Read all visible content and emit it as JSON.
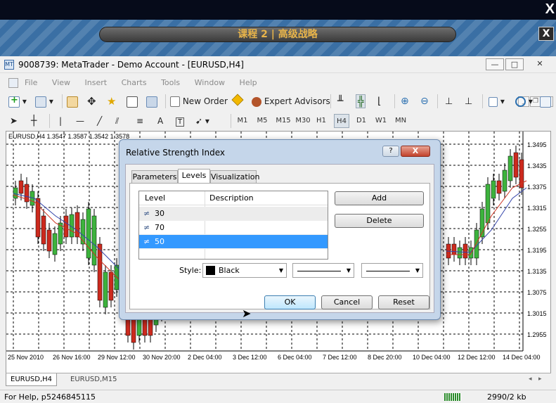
{
  "overlay": {
    "close_glyph": "X",
    "banner_title": "课程 2 | 高级战略",
    "banner_close": "X"
  },
  "window": {
    "title": "9008739: MetaTrader - Demo Account - [EURUSD,H4]",
    "min": "—",
    "max": "□",
    "close": "✕"
  },
  "menu": [
    "File",
    "View",
    "Insert",
    "Charts",
    "Tools",
    "Window",
    "Help"
  ],
  "toolbar": {
    "new_order": "New Order",
    "expert_advisors": "Expert Advisors"
  },
  "timeframes": [
    "M1",
    "M5",
    "M15",
    "M30",
    "H1",
    "H4",
    "D1",
    "W1",
    "MN"
  ],
  "selected_timeframe": "H4",
  "chart": {
    "label": "EURUSD,H4  1.3547 1.3587 1.3542 1.3578",
    "price_axis": [
      "1.3495",
      "1.3435",
      "1.3375",
      "1.3315",
      "1.3255",
      "1.3195",
      "1.3135",
      "1.3075",
      "1.3015",
      "1.2955"
    ],
    "date_axis": [
      "25 Nov 2010",
      "26 Nov 16:00",
      "29 Nov 12:00",
      "30 Nov 20:00",
      "2 Dec 04:00",
      "3 Dec 12:00",
      "6 Dec 04:00",
      "7 Dec 12:00",
      "8 Dec 20:00",
      "10 Dec 04:00",
      "12 Dec 12:00",
      "14 Dec 04:00"
    ],
    "up_color": "#3db33d",
    "down_color": "#cc2a1e"
  },
  "chart_tabs": [
    "EURUSD,H4",
    "EURUSD,M15"
  ],
  "status": {
    "help": "For Help, p",
    "number": "5246845115",
    "traffic": "2990/2 kb"
  },
  "dialog": {
    "title": "Relative Strength Index",
    "help": "?",
    "close": "X",
    "tabs": [
      "Parameters",
      "Levels",
      "Visualization"
    ],
    "active_tab": "Levels",
    "columns": [
      "Level",
      "Description"
    ],
    "levels": [
      {
        "value": "30",
        "description": ""
      },
      {
        "value": "70",
        "description": ""
      },
      {
        "value": "50",
        "description": ""
      }
    ],
    "selected_level": "50",
    "add": "Add",
    "delete": "Delete",
    "style_label": "Style:",
    "color_value": "Black",
    "ok": "OK",
    "cancel": "Cancel",
    "reset": "Reset"
  }
}
